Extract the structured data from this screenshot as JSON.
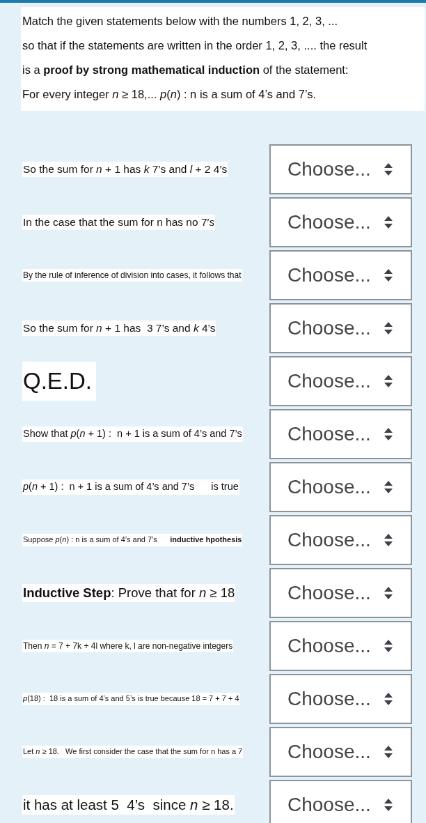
{
  "instructions": [
    "Match the given statements below with the numbers 1, 2, 3, ...",
    "so that if the statements are written in the order 1, 2, 3, .... the result",
    "is a **proof by strong mathematical induction** of the statement:",
    "For every integer *n* ≥ 18,... *p*(*n*) :  n is a sum of 4’s and 7’s."
  ],
  "rows": [
    {
      "text": "So the sum for *n* + 1 has *k* 7’s and *l* + 2 4’s",
      "dropdown": "Choose..."
    },
    {
      "text": "In the case that the sum for n has no 7′*s*",
      "dropdown": "Choose..."
    },
    {
      "text": "By the rule of inference of division into cases, it follows that",
      "dropdown": "Choose..."
    },
    {
      "text": "So the sum for *n* + 1 has  3 7’s and *k* 4’s",
      "dropdown": "Choose..."
    },
    {
      "text": "Q.E.D.",
      "dropdown": "Choose..."
    },
    {
      "text": "Show that *p*(*n* + 1) :  n + 1 is a sum of 4’s and 7’s",
      "dropdown": "Choose..."
    },
    {
      "text": "*p*(*n* + 1) :  n + 1 is a sum of 4’s and 7’s      is true",
      "dropdown": "Choose..."
    },
    {
      "text": "Suppose *p*(*n*) : n is a sum of 4’s and 7’s      **inductive hpothesis**",
      "dropdown": "Choose..."
    },
    {
      "text": "**Inductive Step**: Prove that for *n* ≥ 18",
      "dropdown": "Choose..."
    },
    {
      "text": "Then *n* = 7 + 7k + 4l where k, l are non-negative integers",
      "dropdown": "Choose..."
    },
    {
      "text": "*p*(18) :  18 is a sum of 4’s and 5’s is true because 18 = 7 + 7 + 4",
      "dropdown": "Choose..."
    },
    {
      "text": "Let *n* ≥ 18.   We first consider the case that the sum for n has a 7",
      "dropdown": "Choose..."
    },
    {
      "text": "it has at least 5  4’s  since *n* ≥ 18.",
      "dropdown": "Choose..."
    }
  ]
}
